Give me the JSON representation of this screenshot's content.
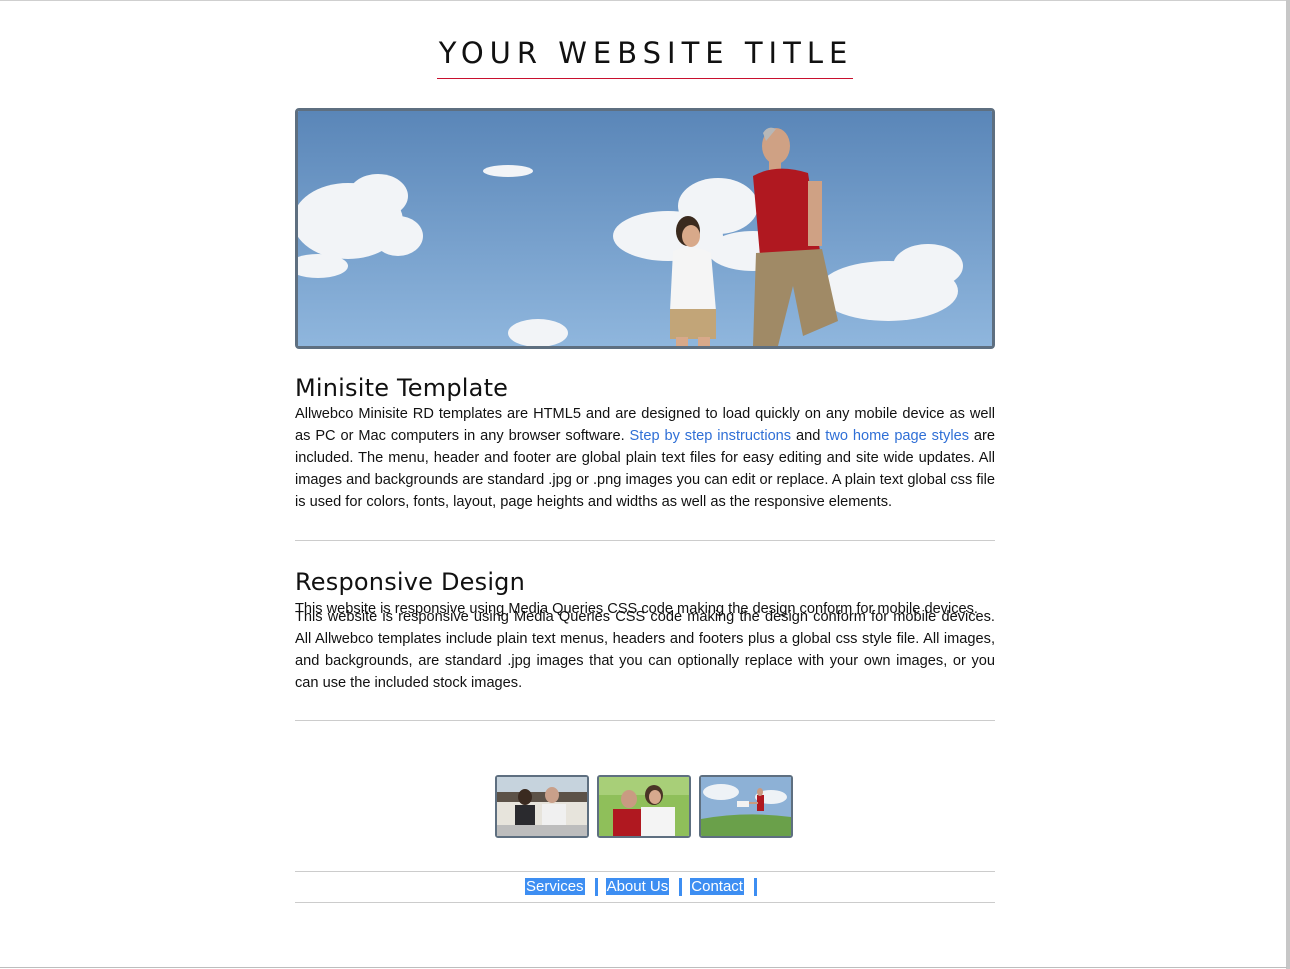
{
  "site": {
    "title": "YOUR WEBSITE TITLE"
  },
  "hero": {
    "description": ""
  },
  "sections": [
    {
      "heading": "Minisite Template",
      "text_before": "Allwebco Minisite RD templates are HTML5 and are designed to load quickly on any mobile device as well as PC or Mac computers in any browser software. ",
      "link1": "Step by step instructions",
      "text_mid": " and ",
      "link2": "two home page styles",
      "text_after": " are included. The menu, header and footer are global plain text files for easy editing and site wide updates. All images and backgrounds are standard .jpg or .png images you can edit or replace. A plain text global css file is used for colors, fonts, layout, page heights and widths as well as the responsive elements."
    },
    {
      "heading": "Responsive Design",
      "overlap_text": "This website is responsive using Media Queries CSS code making the design conform for mobile devices.",
      "text": "This website is responsive using Media Queries CSS code making the design conform for mobile devices. All Allwebco templates include plain text menus, headers and footers plus a global css style file. All images, and backgrounds, are standard .jpg images that you can optionally replace with your own images, or you can use the included stock images."
    }
  ],
  "footer": {
    "links": [
      "Services",
      "About Us",
      "Contact"
    ]
  },
  "colors": {
    "accent": "#c8102e",
    "link": "#2f6fd6",
    "highlight": "#3d8ef2",
    "frame": "#5e6f80"
  }
}
